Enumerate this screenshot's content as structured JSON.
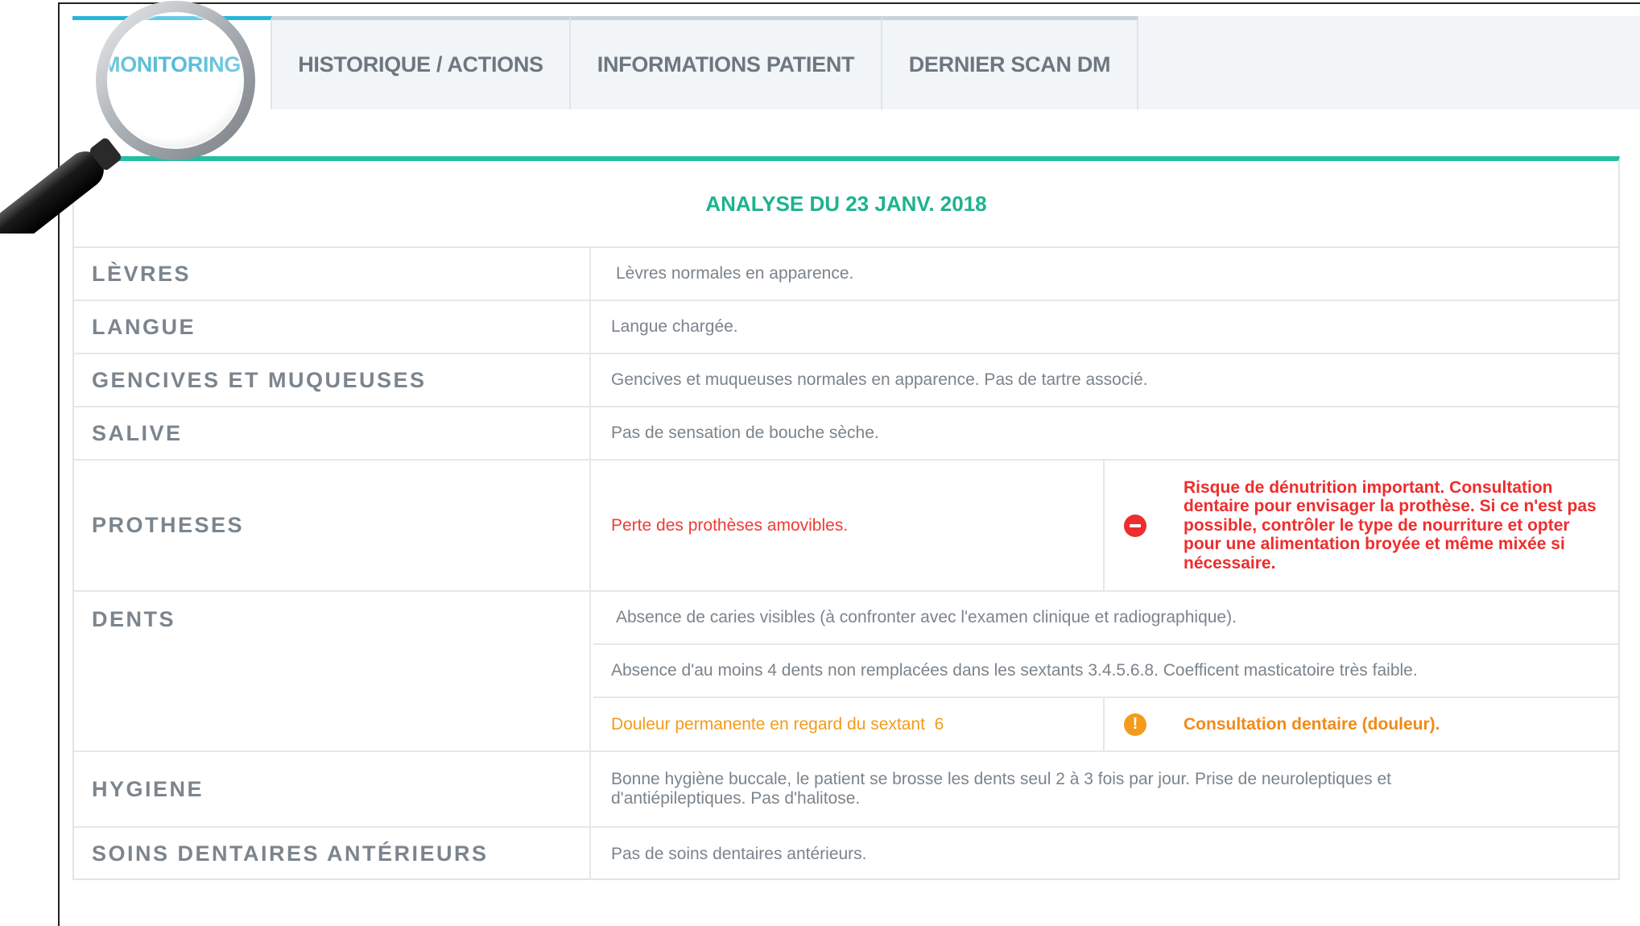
{
  "tabs": [
    {
      "label": "MONITORING",
      "active": true
    },
    {
      "label": "HISTORIQUE / ACTIONS",
      "active": false
    },
    {
      "label": "INFORMATIONS PATIENT",
      "active": false
    },
    {
      "label": "DERNIER SCAN DM",
      "active": false
    }
  ],
  "analysis": {
    "title": "ANALYSE DU 23 JANV. 2018",
    "rows": {
      "levres": {
        "label": "LÈVRES",
        "value": "Lèvres normales en apparence."
      },
      "langue": {
        "label": "LANGUE",
        "value": "Langue chargée."
      },
      "gencives": {
        "label": "GENCIVES ET MUQUEUSES",
        "value": "Gencives et muqueuses normales en apparence. Pas de tartre associé."
      },
      "salive": {
        "label": "SALIVE",
        "value": "Pas de sensation de bouche sèche."
      },
      "protheses": {
        "label": "PROTHESES",
        "value": "Perte des prothèses amovibles.",
        "alert": "Risque de dénutrition important. Consultation dentaire pour envisager la prothèse. Si ce n'est pas possible, contrôler le type de nourriture et opter pour une alimentation broyée et même mixée si nécessaire.",
        "alert_level": "critical"
      },
      "dents": {
        "label": "DENTS",
        "values": [
          "Absence de caries visibles (à confronter avec l'examen clinique et radiographique).",
          "Absence d'au moins 4 dents non remplacées dans les sextants 3.4.5.6.8. Coefficent masticatoire très faible.",
          "Douleur permanente en regard du sextant  6"
        ],
        "alert": "Consultation dentaire (douleur).",
        "alert_icon": "!",
        "alert_level": "warning"
      },
      "hygiene": {
        "label": "HYGIENE",
        "value": "Bonne hygiène buccale, le patient se brosse les dents seul 2 à 3 fois par jour. Prise de neuroleptiques et d'antiépileptiques. Pas d'halitose."
      },
      "soins": {
        "label": "SOINS DENTAIRES ANTÉRIEURS",
        "value": "Pas de soins dentaires antérieurs."
      }
    }
  },
  "colors": {
    "accent_tab": "#27b6dc",
    "accent_panel": "#22bfa3",
    "critical": "#ee2d2d",
    "warning": "#f39b1b",
    "label_gray": "#7b858e"
  },
  "icons": [
    "magnifier-icon",
    "critical-minus-icon",
    "warning-exclamation-icon"
  ]
}
